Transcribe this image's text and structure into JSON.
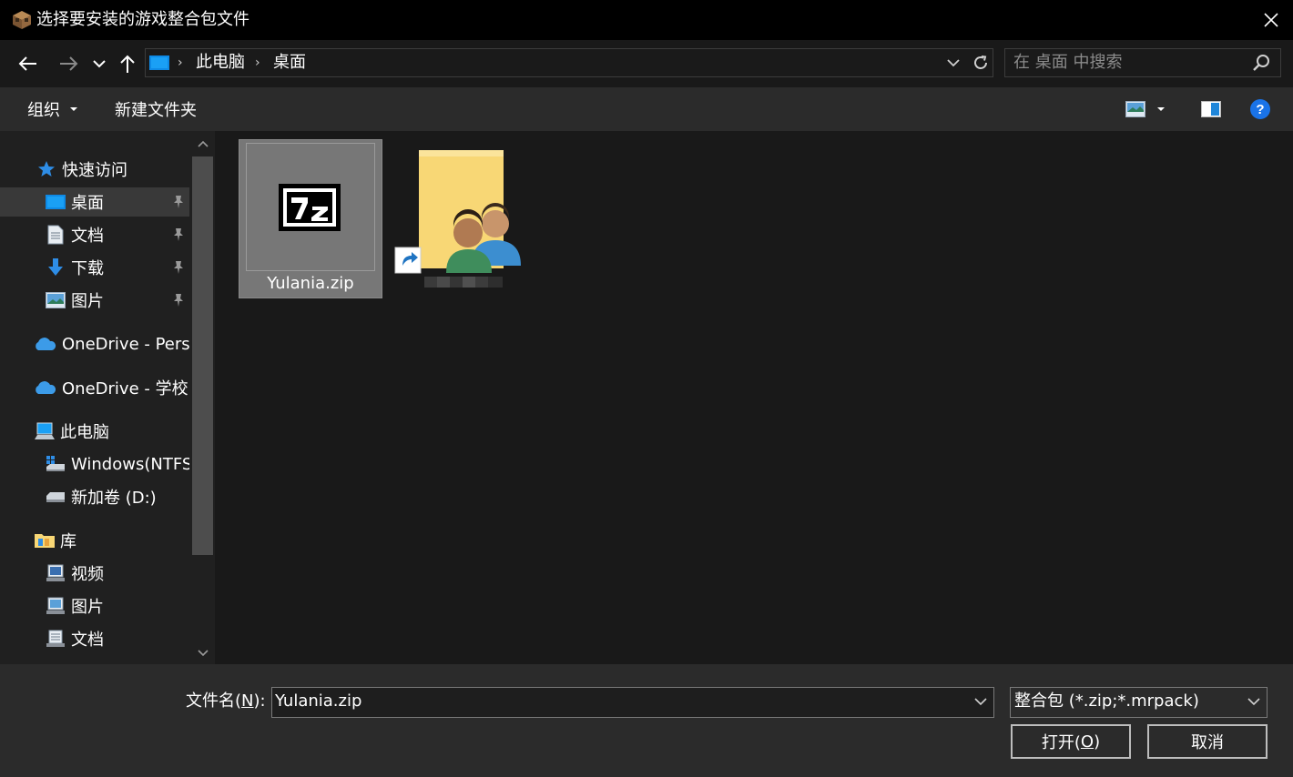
{
  "window": {
    "title": "选择要安装的游戏整合包文件"
  },
  "address": {
    "crumbs": [
      "此电脑",
      "桌面"
    ],
    "separator": "›",
    "search_placeholder": "在 桌面 中搜索"
  },
  "toolbar": {
    "organize_label": "组织",
    "new_folder_label": "新建文件夹"
  },
  "nav": {
    "quick_access": "快速访问",
    "qa_items": [
      "桌面",
      "文档",
      "下载",
      "图片"
    ],
    "onedrive_personal": "OneDrive - Personal",
    "onedrive_school": "OneDrive - 学校",
    "this_pc": "此电脑",
    "drives": [
      "Windows(NTFS)",
      "新加卷 (D:)"
    ],
    "libraries": "库",
    "lib_items": [
      "视频",
      "图片",
      "文档"
    ]
  },
  "files": [
    {
      "name": "Yulania.zip",
      "icon": "7zip-archive-icon",
      "selected": true
    },
    {
      "name": "",
      "icon": "users-folder-shortcut-icon",
      "selected": false
    }
  ],
  "footer": {
    "filename_label_pre": "文件名(",
    "filename_label_key": "N",
    "filename_label_post": "):",
    "filename_value": "Yulania.zip",
    "filter_value": "整合包 (*.zip;*.mrpack)",
    "open_label_pre": "打开(",
    "open_label_key": "O",
    "open_label_post": ")",
    "cancel_label": "取消"
  },
  "colors": {
    "accent": "#0078d7",
    "help": "#1a73e8",
    "onedrive": "#3c9be8",
    "folder": "#f8d775",
    "selected_file_bg": "#777777"
  }
}
